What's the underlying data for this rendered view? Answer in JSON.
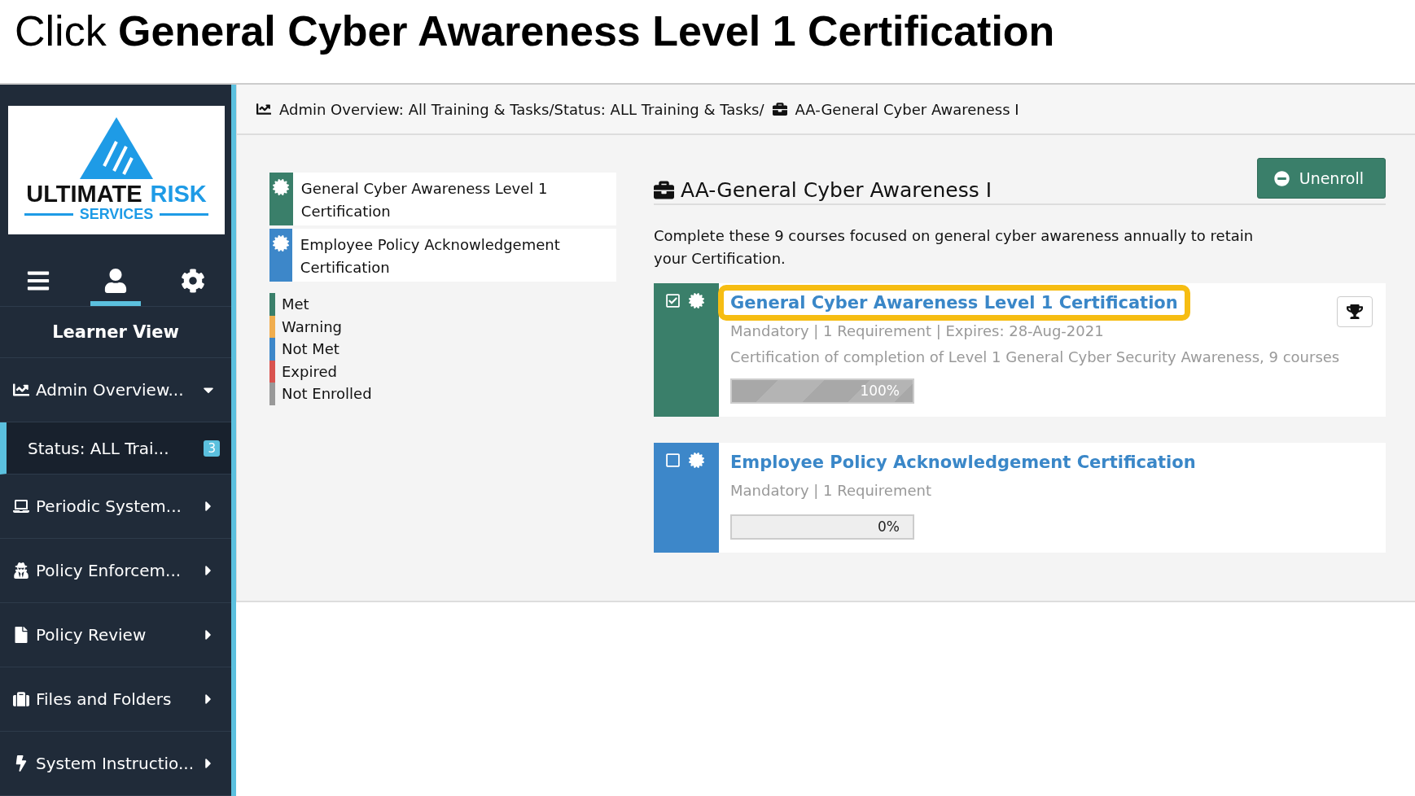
{
  "title": "Click **General Cyber Awareness Level 1 Certification**",
  "sidebar": {
    "logo": {
      "word_1": "ULTIMATE",
      "word_2": "RISK",
      "word_3": "SERVICES"
    },
    "tabs": [
      {
        "kind": "menu",
        "selected": false
      },
      {
        "kind": "user",
        "selected": true
      },
      {
        "kind": "settings",
        "selected": false
      }
    ],
    "view_label": "Learner View",
    "items": [
      {
        "kind": "chart",
        "label": "Admin Overview...",
        "expanded": true,
        "children": [
          {
            "label": "Status: ALL Trai...",
            "badge": "3",
            "selected": true
          }
        ]
      },
      {
        "kind": "laptop",
        "label": "Periodic System...",
        "expanded": false
      },
      {
        "kind": "spy",
        "label": "Policy Enforcem...",
        "expanded": false
      },
      {
        "kind": "file",
        "label": "Policy Review",
        "expanded": false
      },
      {
        "kind": "suitcase",
        "label": "Files and Folders",
        "expanded": false
      },
      {
        "kind": "bolt",
        "label": "System Instructio...",
        "expanded": false
      }
    ]
  },
  "breadcrumb": {
    "path": "Admin Overview: All Training & Tasks/Status: ALL Training & Tasks/",
    "current": "AA-General Cyber Awareness I"
  },
  "certifications": [
    {
      "label": "General Cyber Awareness Level 1 Certification",
      "color": "#3a7f6a"
    },
    {
      "label": "Employee Policy Acknowledgement Certification",
      "color": "#3d87c9"
    }
  ],
  "legend": [
    {
      "label": "Met",
      "color": "#3a7f6a"
    },
    {
      "label": "Warning",
      "color": "#f0ad4e"
    },
    {
      "label": "Not Met",
      "color": "#3d87c9"
    },
    {
      "label": "Expired",
      "color": "#d9534f"
    },
    {
      "label": "Not Enrolled",
      "color": "#999999"
    }
  ],
  "heading": "AA-General Cyber Awareness I",
  "unenroll_button": "Unenroll",
  "description": "Complete these 9 courses focused on general cyber awareness annually to retain your Certification.",
  "courses": [
    {
      "title": "General Cyber Awareness Level 1 Certification",
      "color": "#3a7f6a",
      "checked": true,
      "highlighted": true,
      "trophy": true,
      "meta": "Mandatory | 1 Requirement | Expires: 28-Aug-2021",
      "detail": "Certification of completion of Level 1 General Cyber Security Awareness, 9 courses",
      "level": 1,
      "progress_label": "100%"
    },
    {
      "title": "Employee Policy Acknowledgement Certification",
      "color": "#3d87c9",
      "checked": false,
      "highlighted": false,
      "trophy": false,
      "meta": "Mandatory | 1 Requirement",
      "level": 0,
      "progress_label": "0%"
    }
  ]
}
